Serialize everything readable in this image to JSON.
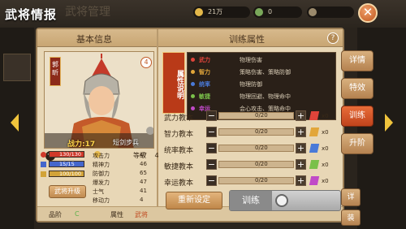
{
  "header": {
    "title": "武将情报",
    "ghost_title": "武将管理",
    "resources": [
      {
        "value": "21万",
        "color": "#e4b84a"
      },
      {
        "value": "0",
        "color": "#7aa85a"
      },
      {
        "value": "",
        "color": "#9b8a6c"
      }
    ],
    "close_label": "✕"
  },
  "panel": {
    "left_header": "基本信息",
    "right_header": "训练属性",
    "help_label": "?"
  },
  "general": {
    "name": "郭昕",
    "star": "4",
    "power": "战力:17",
    "unit_type": "短剑步兵",
    "level_label": "等级",
    "level_value": "4"
  },
  "bars": [
    {
      "text": "130/130",
      "color": "#d03a2a",
      "fill": 1.0,
      "icon_color": "#d03a2a"
    },
    {
      "text": "15/15",
      "color": "#4466cc",
      "fill": 1.0,
      "icon_color": "#4466cc"
    },
    {
      "text": "100/100",
      "color": "#d2a338",
      "fill": 1.0,
      "icon_color": "#d2a338"
    }
  ],
  "attributes": [
    {
      "label": "攻击力",
      "value": "47"
    },
    {
      "label": "精神力",
      "value": "46"
    },
    {
      "label": "防御力",
      "value": "65"
    },
    {
      "label": "爆发力",
      "value": "47"
    },
    {
      "label": "士气",
      "value": "41"
    },
    {
      "label": "移动力",
      "value": "4"
    }
  ],
  "upgrade_label": "武将升级",
  "quality": {
    "label": "品阶",
    "value": "C"
  },
  "attr_type": {
    "label": "属性",
    "value": "武将"
  },
  "attr_desc": {
    "title": "属性说明",
    "rows": [
      {
        "name": "武力",
        "desc": "物理伤害",
        "color": "#e0443a"
      },
      {
        "name": "智力",
        "desc": "策略伤害、策略防御",
        "color": "#e2a63a"
      },
      {
        "name": "统率",
        "desc": "物理防御",
        "color": "#4a7ad8"
      },
      {
        "name": "敏捷",
        "desc": "物理回避、物理命中",
        "color": "#7ac04a"
      },
      {
        "name": "幸运",
        "desc": "会心攻击、策略命中",
        "color": "#c04ac8"
      }
    ]
  },
  "training": [
    {
      "label": "武力教本",
      "count": "0/20",
      "x": "x0",
      "book_color": "#e0443a"
    },
    {
      "label": "智力教本",
      "count": "0/20",
      "x": "x0",
      "book_color": "#e2a63a"
    },
    {
      "label": "统率教本",
      "count": "0/20",
      "x": "x0",
      "book_color": "#4a7ad8"
    },
    {
      "label": "敏捷教本",
      "count": "0/20",
      "x": "x0",
      "book_color": "#7ac04a"
    },
    {
      "label": "幸运教本",
      "count": "0/20",
      "x": "x0",
      "book_color": "#c04ac8"
    }
  ],
  "reset_label": "重新设定",
  "train_label": "训练",
  "tabs": [
    {
      "label": "详情"
    },
    {
      "label": "特效"
    },
    {
      "label": "训练"
    },
    {
      "label": "升阶"
    }
  ],
  "extra_tabs": [
    "详",
    "装"
  ]
}
